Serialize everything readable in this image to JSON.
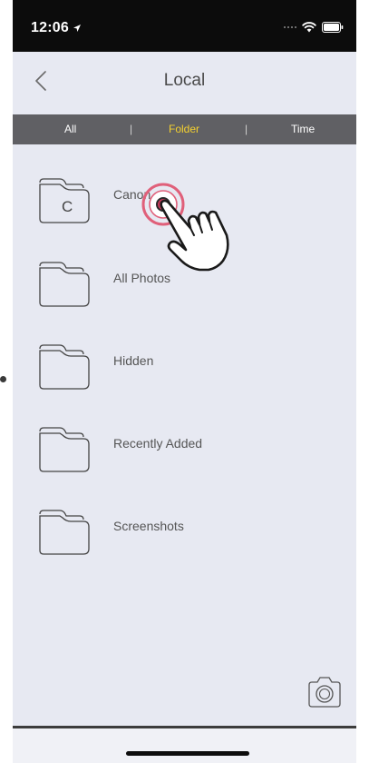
{
  "status_bar": {
    "time": "12:06",
    "location_icon": "location-arrow-icon",
    "wifi_icon": "wifi-icon",
    "battery_icon": "battery-icon"
  },
  "nav": {
    "title": "Local",
    "back_icon": "chevron-left-icon"
  },
  "tabs": [
    {
      "label": "All",
      "active": false
    },
    {
      "label": "Folder",
      "active": true
    },
    {
      "label": "Time",
      "active": false
    }
  ],
  "tab_separator": "|",
  "folders": [
    {
      "name": "Canon",
      "icon_letter": "C"
    },
    {
      "name": "All Photos",
      "icon_letter": ""
    },
    {
      "name": "Hidden",
      "icon_letter": ""
    },
    {
      "name": "Recently Added",
      "icon_letter": ""
    },
    {
      "name": "Screenshots",
      "icon_letter": ""
    }
  ],
  "camera_icon": "camera-icon",
  "colors": {
    "background": "#e7e9f2",
    "tab_bar": "#606064",
    "tab_active": "#f4d02f",
    "tap_ring": "#e0607a"
  }
}
